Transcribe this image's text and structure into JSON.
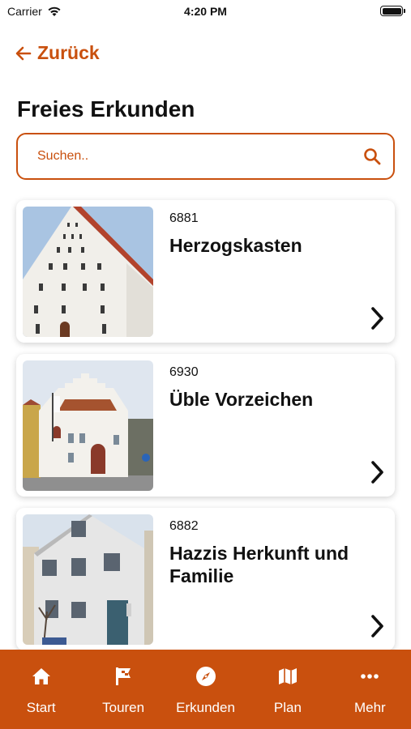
{
  "status_bar": {
    "carrier": "Carrier",
    "time": "4:20 PM"
  },
  "nav": {
    "back_label": "Zurück"
  },
  "page": {
    "title": "Freies Erkunden"
  },
  "search": {
    "placeholder": "Suchen.."
  },
  "items": [
    {
      "id": "6881",
      "title": "Herzogskasten"
    },
    {
      "id": "6930",
      "title": "Üble Vorzeichen"
    },
    {
      "id": "6882",
      "title": "Hazzis Herkunft und Familie"
    }
  ],
  "tabs": [
    {
      "label": "Start",
      "icon": "home-icon"
    },
    {
      "label": "Touren",
      "icon": "flag-icon"
    },
    {
      "label": "Erkunden",
      "icon": "compass-icon"
    },
    {
      "label": "Plan",
      "icon": "map-icon"
    },
    {
      "label": "Mehr",
      "icon": "more-icon"
    }
  ],
  "colors": {
    "accent": "#c9500e",
    "background": "#ffffff",
    "text": "#111111"
  }
}
